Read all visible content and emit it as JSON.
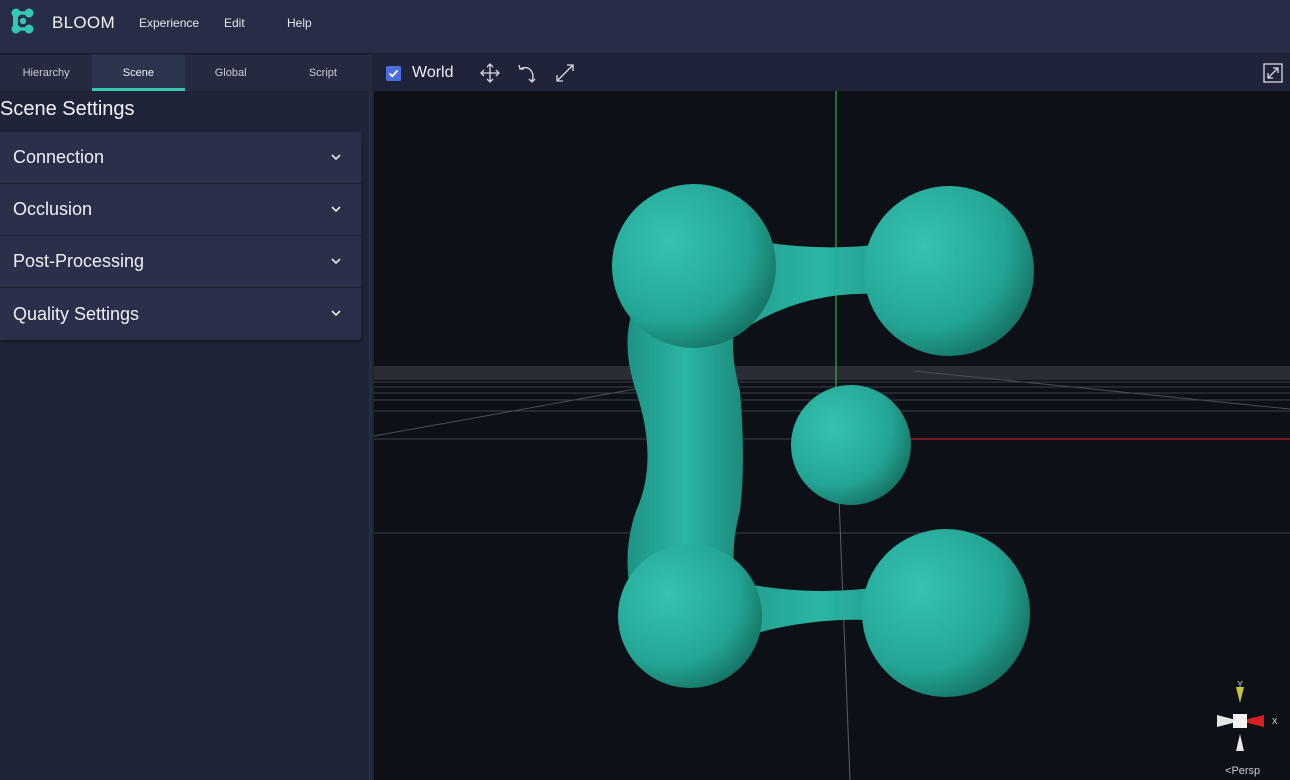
{
  "app": {
    "brand": "BLOOM"
  },
  "menu": {
    "items": [
      "Experience",
      "Edit",
      "Help"
    ]
  },
  "left_panel": {
    "tabs": [
      {
        "label": "Hierarchy",
        "active": false
      },
      {
        "label": "Scene",
        "active": true
      },
      {
        "label": "Global",
        "active": false
      },
      {
        "label": "Script",
        "active": false
      }
    ],
    "section_title": "Scene Settings",
    "accordion": [
      {
        "label": "Connection",
        "expanded": false
      },
      {
        "label": "Occlusion",
        "expanded": false
      },
      {
        "label": "Post-Processing",
        "expanded": false
      },
      {
        "label": "Quality Settings",
        "expanded": false
      }
    ]
  },
  "viewport": {
    "world_checkbox": {
      "label": "World",
      "checked": true
    },
    "tools": [
      "move-icon",
      "rotate-icon",
      "scale-icon",
      "fullscreen-icon"
    ],
    "gizmo": {
      "y_label": "Y",
      "x_label": "X",
      "projection": "Persp"
    }
  },
  "colors": {
    "accent": "#34c8b4",
    "model": "#27a999",
    "checkbox": "#4a6fe0",
    "axis_x": "#d91f1f",
    "axis_y": "#2fd12f",
    "topbar": "#272d45",
    "panel": "#1f2439",
    "viewport_bg": "#0e1017"
  }
}
